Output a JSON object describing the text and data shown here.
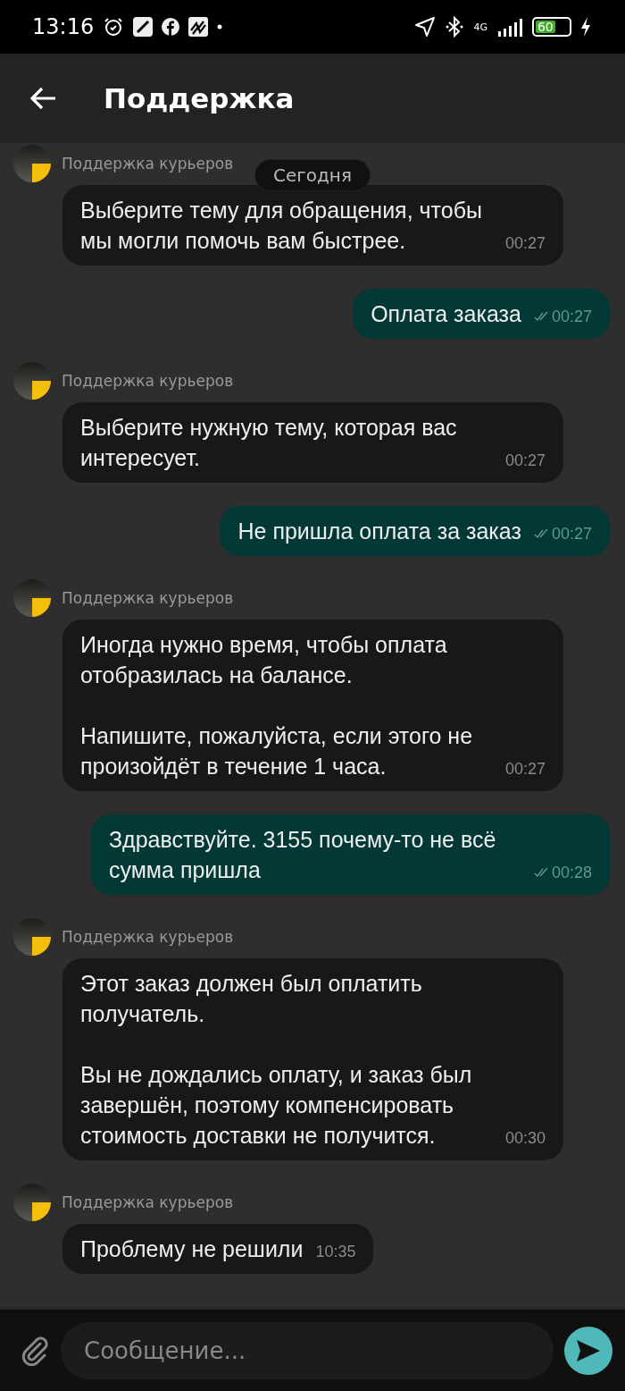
{
  "status_bar": {
    "time": "13:16",
    "battery": "60",
    "network": "4G"
  },
  "header": {
    "title": "Поддержка"
  },
  "date_chip": "Сегодня",
  "messages": [
    {
      "kind": "incoming",
      "sender": "Поддержка курьеров",
      "text": "Выберите тему для обращения, чтобы мы могли помочь вам быстрее.",
      "time": "00:27"
    },
    {
      "kind": "outgoing",
      "text": "Оплата заказа",
      "time": "00:27",
      "read": true
    },
    {
      "kind": "incoming",
      "sender": "Поддержка курьеров",
      "text": "Выберите нужную тему, которая вас интересует.",
      "time": "00:27"
    },
    {
      "kind": "outgoing",
      "text": "Не пришла оплата за заказ",
      "time": "00:27",
      "read": true
    },
    {
      "kind": "incoming",
      "sender": "Поддержка курьеров",
      "text": "Иногда нужно время, чтобы оплата отобразилась на балансе.\n\nНапишите, пожалуйста, если этого не произойдёт в течение 1 часа.",
      "time": "00:27"
    },
    {
      "kind": "outgoing",
      "text": "Здравствуйте. 3155 почему-то не всё сумма пришла",
      "time": "00:28",
      "read": true
    },
    {
      "kind": "incoming",
      "sender": "Поддержка курьеров",
      "text": "Этот заказ должен был оплатить получатель.\n\nВы не дождались оплату, и заказ был завершён, поэтому компенсировать стоимость доставки не получится.",
      "time": "00:30"
    },
    {
      "kind": "incoming",
      "sender": "Поддержка курьеров",
      "text": "Проблему не решили",
      "time": "10:35"
    }
  ],
  "composer": {
    "placeholder": "Сообщение..."
  }
}
